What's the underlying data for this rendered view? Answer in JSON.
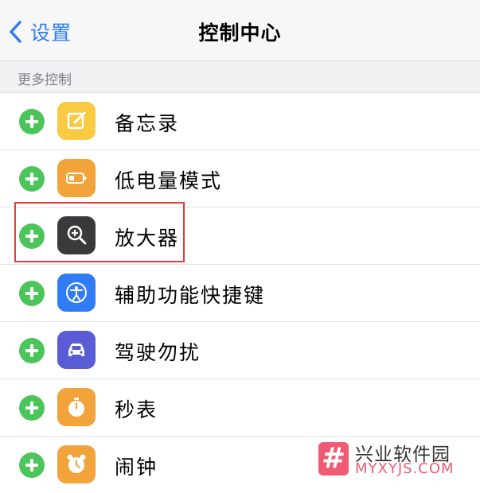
{
  "nav": {
    "back_label": "设置",
    "title": "控制中心"
  },
  "section": {
    "header": "更多控制"
  },
  "items": [
    {
      "label": "备忘录",
      "icon": "notes-icon",
      "color": "#f8cb43"
    },
    {
      "label": "低电量模式",
      "icon": "low-power-icon",
      "color": "#f2a33a"
    },
    {
      "label": "放大器",
      "icon": "magnifier-icon",
      "color": "#3a3a3c"
    },
    {
      "label": "辅助功能快捷键",
      "icon": "accessibility-icon",
      "color": "#2f7cf6"
    },
    {
      "label": "驾驶勿扰",
      "icon": "car-icon",
      "color": "#5a5cd6"
    },
    {
      "label": "秒表",
      "icon": "stopwatch-icon",
      "color": "#f2a33a"
    },
    {
      "label": "闹钟",
      "icon": "alarm-clock-icon",
      "color": "#f2a33a"
    }
  ],
  "watermark": {
    "logo": "#",
    "title": "兴业软件园",
    "url": "MYXYJS.COM"
  }
}
